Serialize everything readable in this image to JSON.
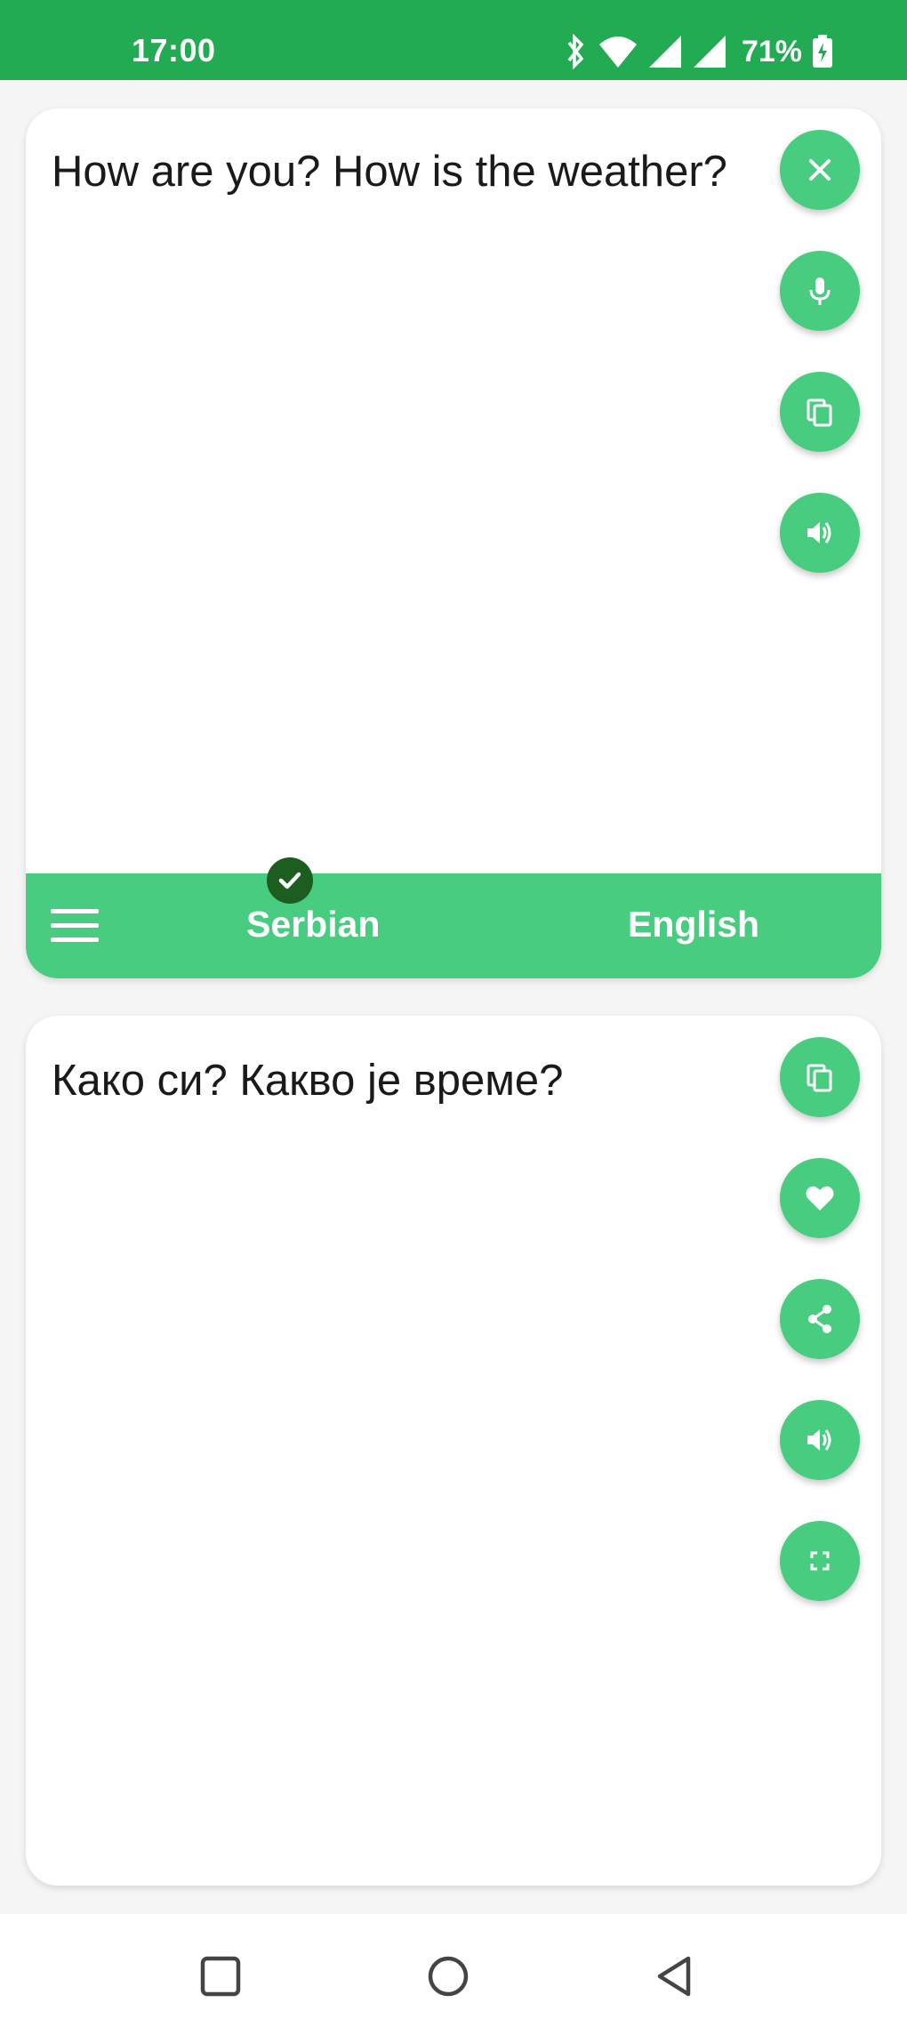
{
  "status_bar": {
    "time": "17:00",
    "battery_text": "71%",
    "icons": [
      "bluetooth-icon",
      "wifi-icon",
      "signal-icon",
      "signal-icon",
      "battery-charging-icon"
    ]
  },
  "input_panel": {
    "text": "How are you? How is the weather?",
    "buttons": [
      "clear-icon",
      "microphone-icon",
      "copy-icon",
      "speaker-icon"
    ]
  },
  "language_bar": {
    "menu_icon": "hamburger-menu-icon",
    "source_language": "Serbian",
    "target_language": "English",
    "selected_indicator": "check-icon"
  },
  "output_panel": {
    "text": "Како си? Какво је време?",
    "buttons": [
      "copy-icon",
      "heart-icon",
      "share-icon",
      "speaker-icon",
      "fullscreen-icon"
    ]
  },
  "nav_bar": {
    "buttons": [
      "recents-square-icon",
      "home-circle-icon",
      "back-triangle-icon"
    ]
  },
  "colors": {
    "status_bar": "#22ab52",
    "accent": "#47cc80",
    "check_badge": "#1b5e20",
    "background": "#f5f5f5"
  }
}
